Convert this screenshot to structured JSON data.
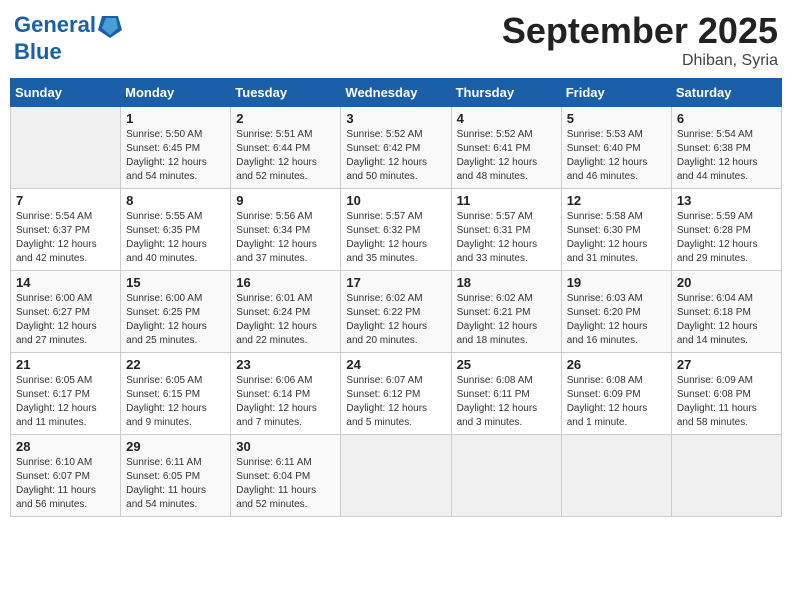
{
  "header": {
    "logo_line1": "General",
    "logo_line2": "Blue",
    "month": "September 2025",
    "location": "Dhiban, Syria"
  },
  "days_of_week": [
    "Sunday",
    "Monday",
    "Tuesday",
    "Wednesday",
    "Thursday",
    "Friday",
    "Saturday"
  ],
  "weeks": [
    [
      {
        "day": "",
        "content": ""
      },
      {
        "day": "1",
        "content": "Sunrise: 5:50 AM\nSunset: 6:45 PM\nDaylight: 12 hours\nand 54 minutes."
      },
      {
        "day": "2",
        "content": "Sunrise: 5:51 AM\nSunset: 6:44 PM\nDaylight: 12 hours\nand 52 minutes."
      },
      {
        "day": "3",
        "content": "Sunrise: 5:52 AM\nSunset: 6:42 PM\nDaylight: 12 hours\nand 50 minutes."
      },
      {
        "day": "4",
        "content": "Sunrise: 5:52 AM\nSunset: 6:41 PM\nDaylight: 12 hours\nand 48 minutes."
      },
      {
        "day": "5",
        "content": "Sunrise: 5:53 AM\nSunset: 6:40 PM\nDaylight: 12 hours\nand 46 minutes."
      },
      {
        "day": "6",
        "content": "Sunrise: 5:54 AM\nSunset: 6:38 PM\nDaylight: 12 hours\nand 44 minutes."
      }
    ],
    [
      {
        "day": "7",
        "content": "Sunrise: 5:54 AM\nSunset: 6:37 PM\nDaylight: 12 hours\nand 42 minutes."
      },
      {
        "day": "8",
        "content": "Sunrise: 5:55 AM\nSunset: 6:35 PM\nDaylight: 12 hours\nand 40 minutes."
      },
      {
        "day": "9",
        "content": "Sunrise: 5:56 AM\nSunset: 6:34 PM\nDaylight: 12 hours\nand 37 minutes."
      },
      {
        "day": "10",
        "content": "Sunrise: 5:57 AM\nSunset: 6:32 PM\nDaylight: 12 hours\nand 35 minutes."
      },
      {
        "day": "11",
        "content": "Sunrise: 5:57 AM\nSunset: 6:31 PM\nDaylight: 12 hours\nand 33 minutes."
      },
      {
        "day": "12",
        "content": "Sunrise: 5:58 AM\nSunset: 6:30 PM\nDaylight: 12 hours\nand 31 minutes."
      },
      {
        "day": "13",
        "content": "Sunrise: 5:59 AM\nSunset: 6:28 PM\nDaylight: 12 hours\nand 29 minutes."
      }
    ],
    [
      {
        "day": "14",
        "content": "Sunrise: 6:00 AM\nSunset: 6:27 PM\nDaylight: 12 hours\nand 27 minutes."
      },
      {
        "day": "15",
        "content": "Sunrise: 6:00 AM\nSunset: 6:25 PM\nDaylight: 12 hours\nand 25 minutes."
      },
      {
        "day": "16",
        "content": "Sunrise: 6:01 AM\nSunset: 6:24 PM\nDaylight: 12 hours\nand 22 minutes."
      },
      {
        "day": "17",
        "content": "Sunrise: 6:02 AM\nSunset: 6:22 PM\nDaylight: 12 hours\nand 20 minutes."
      },
      {
        "day": "18",
        "content": "Sunrise: 6:02 AM\nSunset: 6:21 PM\nDaylight: 12 hours\nand 18 minutes."
      },
      {
        "day": "19",
        "content": "Sunrise: 6:03 AM\nSunset: 6:20 PM\nDaylight: 12 hours\nand 16 minutes."
      },
      {
        "day": "20",
        "content": "Sunrise: 6:04 AM\nSunset: 6:18 PM\nDaylight: 12 hours\nand 14 minutes."
      }
    ],
    [
      {
        "day": "21",
        "content": "Sunrise: 6:05 AM\nSunset: 6:17 PM\nDaylight: 12 hours\nand 11 minutes."
      },
      {
        "day": "22",
        "content": "Sunrise: 6:05 AM\nSunset: 6:15 PM\nDaylight: 12 hours\nand 9 minutes."
      },
      {
        "day": "23",
        "content": "Sunrise: 6:06 AM\nSunset: 6:14 PM\nDaylight: 12 hours\nand 7 minutes."
      },
      {
        "day": "24",
        "content": "Sunrise: 6:07 AM\nSunset: 6:12 PM\nDaylight: 12 hours\nand 5 minutes."
      },
      {
        "day": "25",
        "content": "Sunrise: 6:08 AM\nSunset: 6:11 PM\nDaylight: 12 hours\nand 3 minutes."
      },
      {
        "day": "26",
        "content": "Sunrise: 6:08 AM\nSunset: 6:09 PM\nDaylight: 12 hours\nand 1 minute."
      },
      {
        "day": "27",
        "content": "Sunrise: 6:09 AM\nSunset: 6:08 PM\nDaylight: 11 hours\nand 58 minutes."
      }
    ],
    [
      {
        "day": "28",
        "content": "Sunrise: 6:10 AM\nSunset: 6:07 PM\nDaylight: 11 hours\nand 56 minutes."
      },
      {
        "day": "29",
        "content": "Sunrise: 6:11 AM\nSunset: 6:05 PM\nDaylight: 11 hours\nand 54 minutes."
      },
      {
        "day": "30",
        "content": "Sunrise: 6:11 AM\nSunset: 6:04 PM\nDaylight: 11 hours\nand 52 minutes."
      },
      {
        "day": "",
        "content": ""
      },
      {
        "day": "",
        "content": ""
      },
      {
        "day": "",
        "content": ""
      },
      {
        "day": "",
        "content": ""
      }
    ]
  ]
}
